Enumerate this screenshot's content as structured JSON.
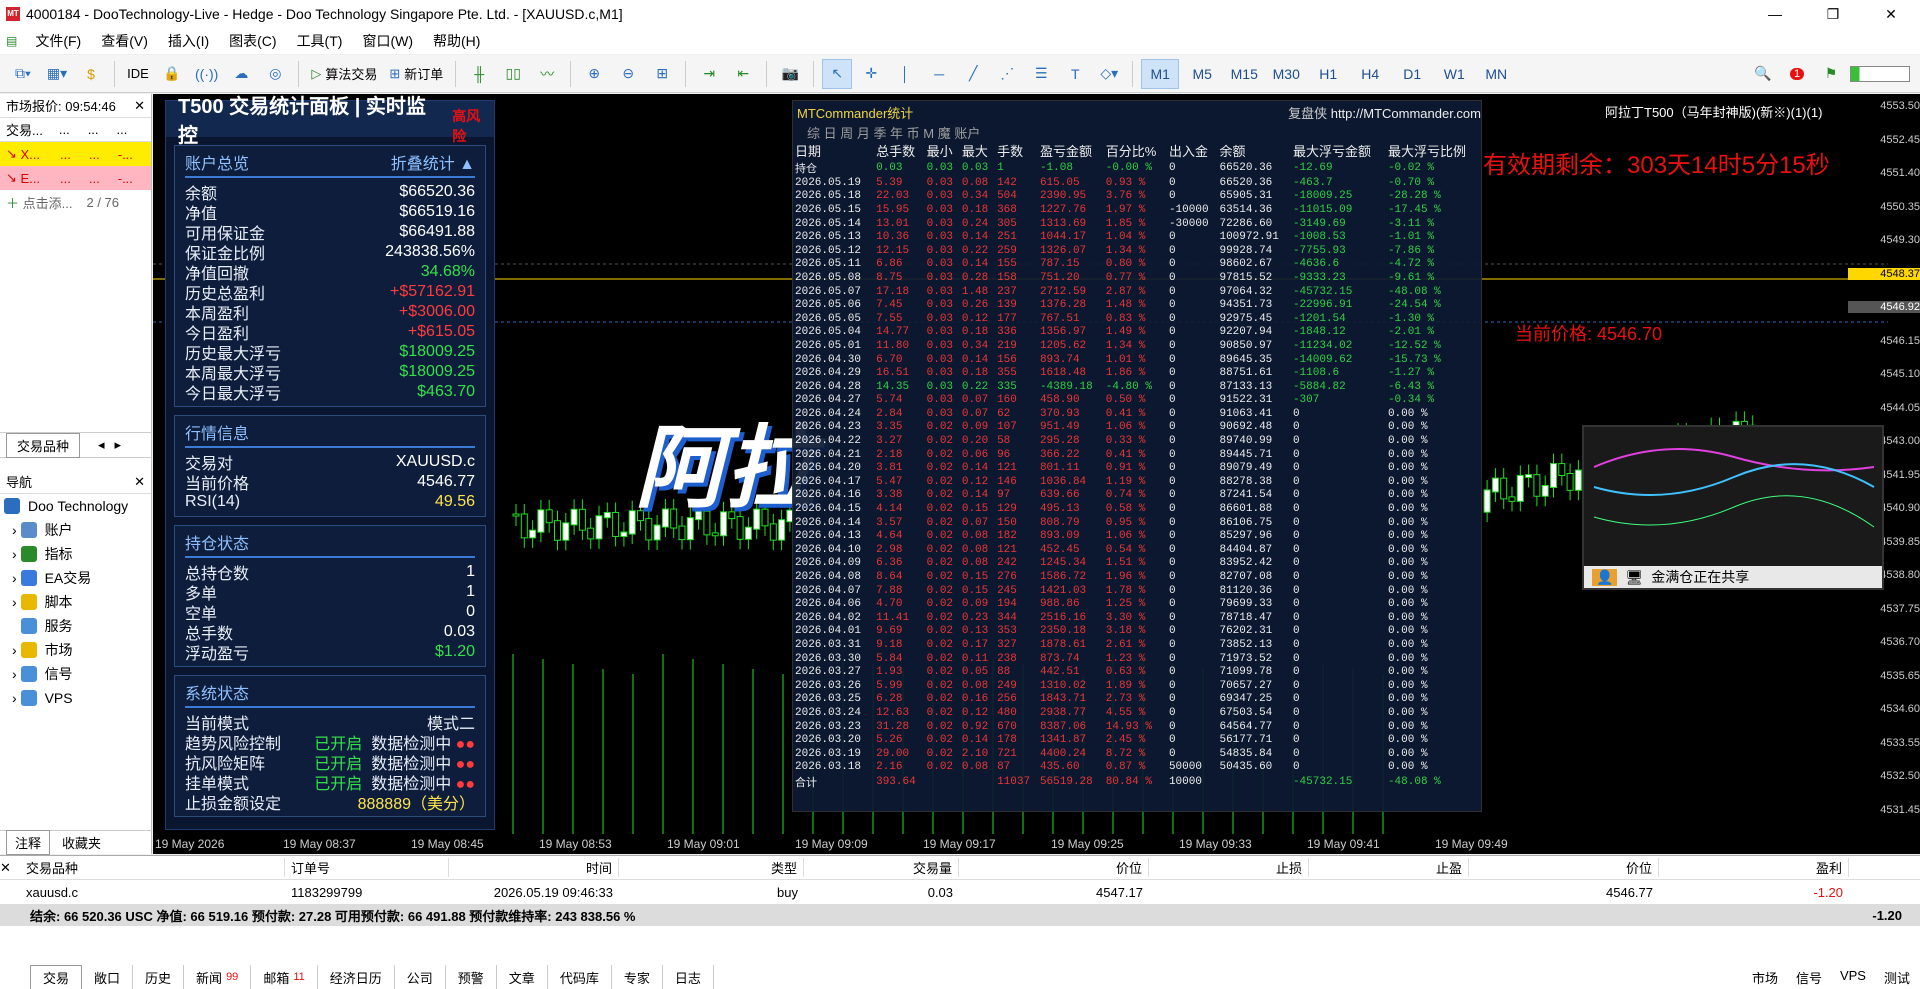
{
  "window": {
    "title": "4000184 - DooTechnology-Live - Hedge - Doo Technology Singapore Pte. Ltd. - [XAUUSD.c,M1]"
  },
  "menu": [
    "文件(F)",
    "查看(V)",
    "插入(I)",
    "图表(C)",
    "工具(T)",
    "窗口(W)",
    "帮助(H)"
  ],
  "toolbar": {
    "ide": "IDE",
    "algo_trading": "算法交易",
    "new_order": "新订单",
    "timeframes": [
      "M1",
      "M5",
      "M15",
      "M30",
      "H1",
      "H4",
      "D1",
      "W1",
      "MN"
    ],
    "active_timeframe": "M1",
    "notification_count": "1"
  },
  "market_watch": {
    "header": "市场报价: 09:54:46",
    "col": "交易...",
    "rows": [
      {
        "symbol": "X...",
        "bg": "#ffec00"
      },
      {
        "symbol": "E...",
        "bg": "#ffb6c1"
      }
    ],
    "add_label": "点击添...",
    "count": "2 / 76",
    "tab": "交易品种"
  },
  "navigator": {
    "header": "导航",
    "broker": "Doo Technology",
    "items": [
      "账户",
      "指标",
      "EA交易",
      "脚本",
      "服务",
      "市场",
      "信号",
      "VPS"
    ],
    "tabs": [
      "注释",
      "收藏夹"
    ]
  },
  "stats_panel": {
    "title": "T500 交易统计面板 | 实时监控",
    "risk": "高风险",
    "account": {
      "title": "账户总览",
      "collapse": "折叠统计 ▲",
      "rows": [
        {
          "k": "余额",
          "v": "$66520.36",
          "c": ""
        },
        {
          "k": "净值",
          "v": "$66519.16",
          "c": ""
        },
        {
          "k": "可用保证金",
          "v": "$66491.88",
          "c": ""
        },
        {
          "k": "保证金比例",
          "v": "243838.56%",
          "c": ""
        },
        {
          "k": "净值回撤",
          "v": "34.68%",
          "c": "g"
        },
        {
          "k": "历史总盈利",
          "v": "+$57162.91",
          "c": "r"
        },
        {
          "k": "本周盈利",
          "v": "+$3006.00",
          "c": "r"
        },
        {
          "k": "今日盈利",
          "v": "+$615.05",
          "c": "r"
        },
        {
          "k": "历史最大浮亏",
          "v": "$18009.25",
          "c": "g"
        },
        {
          "k": "本周最大浮亏",
          "v": "$18009.25",
          "c": "g"
        },
        {
          "k": "今日最大浮亏",
          "v": "$463.70",
          "c": "g"
        }
      ]
    },
    "market": {
      "title": "行情信息",
      "rows": [
        {
          "k": "交易对",
          "v": "XAUUSD.c",
          "c": ""
        },
        {
          "k": "当前价格",
          "v": "4546.77",
          "c": ""
        },
        {
          "k": "RSI(14)",
          "v": "49.56",
          "c": "y"
        }
      ]
    },
    "position": {
      "title": "持仓状态",
      "rows": [
        {
          "k": "总持仓数",
          "v": "1",
          "c": ""
        },
        {
          "k": "多单",
          "v": "1",
          "c": ""
        },
        {
          "k": "空单",
          "v": "0",
          "c": ""
        },
        {
          "k": "总手数",
          "v": "0.03",
          "c": ""
        },
        {
          "k": "浮动盈亏",
          "v": "$1.20",
          "c": "g"
        }
      ]
    },
    "system": {
      "title": "系统状态",
      "mode_label": "当前模式",
      "mode_value": "模式二",
      "rows": [
        {
          "k": "趋势风险控制",
          "s": "已开启",
          "d": "数据检测中"
        },
        {
          "k": "抗风险矩阵",
          "s": "已开启",
          "d": "数据检测中"
        },
        {
          "k": "挂单模式",
          "s": "已开启",
          "d": "数据检测中"
        }
      ],
      "stop_label": "止损金额设定",
      "stop_value": "888889（美分）"
    }
  },
  "mtc": {
    "title": "MTCommander统计",
    "review": "复盘侠",
    "url": "http://MTCommander.com",
    "tabs": "综 日 周 月 季 年 币 M 魔 账户",
    "headers": [
      "日期",
      "总手数",
      "最小",
      "最大",
      "手数",
      "盈亏金额",
      "百分比%",
      "出入金",
      "余额",
      "最大浮亏金额",
      "最大浮亏比例"
    ],
    "rows": [
      [
        "持仓",
        "0.03",
        "0.03",
        "0.03",
        "1",
        "-1.08",
        "-0.00 %",
        "0",
        "66520.36",
        "-12.69",
        "-0.02 %"
      ],
      [
        "2026.05.19",
        "5.39",
        "0.03",
        "0.08",
        "142",
        "615.05",
        "0.93 %",
        "0",
        "66520.36",
        "-463.7",
        "-0.70 %"
      ],
      [
        "2026.05.18",
        "22.03",
        "0.03",
        "0.34",
        "504",
        "2390.95",
        "3.76 %",
        "0",
        "65905.31",
        "-18009.25",
        "-28.28 %"
      ],
      [
        "2026.05.15",
        "15.95",
        "0.03",
        "0.18",
        "368",
        "1227.76",
        "1.97 %",
        "-10000",
        "63514.36",
        "-11015.09",
        "-17.45 %"
      ],
      [
        "2026.05.14",
        "13.01",
        "0.03",
        "0.24",
        "305",
        "1313.69",
        "1.85 %",
        "-30000",
        "72286.60",
        "-3149.69",
        "-3.11 %"
      ],
      [
        "2026.05.13",
        "10.36",
        "0.03",
        "0.14",
        "251",
        "1044.17",
        "1.04 %",
        "0",
        "100972.91",
        "-1008.53",
        "-1.01 %"
      ],
      [
        "2026.05.12",
        "12.15",
        "0.03",
        "0.22",
        "259",
        "1326.07",
        "1.34 %",
        "0",
        "99928.74",
        "-7755.93",
        "-7.86 %"
      ],
      [
        "2026.05.11",
        "6.86",
        "0.03",
        "0.14",
        "155",
        "787.15",
        "0.80 %",
        "0",
        "98602.67",
        "-4636.6",
        "-4.72 %"
      ],
      [
        "2026.05.08",
        "8.75",
        "0.03",
        "0.28",
        "158",
        "751.20",
        "0.77 %",
        "0",
        "97815.52",
        "-9333.23",
        "-9.61 %"
      ],
      [
        "2026.05.07",
        "17.18",
        "0.03",
        "1.48",
        "237",
        "2712.59",
        "2.87 %",
        "0",
        "97064.32",
        "-45732.15",
        "-48.08 %"
      ],
      [
        "2026.05.06",
        "7.45",
        "0.03",
        "0.26",
        "139",
        "1376.28",
        "1.48 %",
        "0",
        "94351.73",
        "-22996.91",
        "-24.54 %"
      ],
      [
        "2026.05.05",
        "7.55",
        "0.03",
        "0.12",
        "177",
        "767.51",
        "0.83 %",
        "0",
        "92975.45",
        "-1201.54",
        "-1.30 %"
      ],
      [
        "2026.05.04",
        "14.77",
        "0.03",
        "0.18",
        "336",
        "1356.97",
        "1.49 %",
        "0",
        "92207.94",
        "-1848.12",
        "-2.01 %"
      ],
      [
        "2026.05.01",
        "11.80",
        "0.03",
        "0.34",
        "219",
        "1205.62",
        "1.34 %",
        "0",
        "90850.97",
        "-11234.02",
        "-12.52 %"
      ],
      [
        "2026.04.30",
        "6.70",
        "0.03",
        "0.14",
        "156",
        "893.74",
        "1.01 %",
        "0",
        "89645.35",
        "-14009.62",
        "-15.73 %"
      ],
      [
        "2026.04.29",
        "16.51",
        "0.03",
        "0.18",
        "355",
        "1618.48",
        "1.86 %",
        "0",
        "88751.61",
        "-1108.6",
        "-1.27 %"
      ],
      [
        "2026.04.28",
        "14.35",
        "0.03",
        "0.22",
        "335",
        "-4389.18",
        "-4.80 %",
        "0",
        "87133.13",
        "-5884.82",
        "-6.43 %"
      ],
      [
        "2026.04.27",
        "5.74",
        "0.03",
        "0.07",
        "160",
        "458.90",
        "0.50 %",
        "0",
        "91522.31",
        "-307",
        "-0.34 %"
      ],
      [
        "2026.04.24",
        "2.84",
        "0.03",
        "0.07",
        "62",
        "370.93",
        "0.41 %",
        "0",
        "91063.41",
        "0",
        "0.00 %"
      ],
      [
        "2026.04.23",
        "3.35",
        "0.02",
        "0.09",
        "107",
        "951.49",
        "1.06 %",
        "0",
        "90692.48",
        "0",
        "0.00 %"
      ],
      [
        "2026.04.22",
        "3.27",
        "0.02",
        "0.20",
        "58",
        "295.28",
        "0.33 %",
        "0",
        "89740.99",
        "0",
        "0.00 %"
      ],
      [
        "2026.04.21",
        "2.18",
        "0.02",
        "0.06",
        "96",
        "366.22",
        "0.41 %",
        "0",
        "89445.71",
        "0",
        "0.00 %"
      ],
      [
        "2026.04.20",
        "3.81",
        "0.02",
        "0.14",
        "121",
        "801.11",
        "0.91 %",
        "0",
        "89079.49",
        "0",
        "0.00 %"
      ],
      [
        "2026.04.17",
        "5.47",
        "0.02",
        "0.12",
        "146",
        "1036.84",
        "1.19 %",
        "0",
        "88278.38",
        "0",
        "0.00 %"
      ],
      [
        "2026.04.16",
        "3.38",
        "0.02",
        "0.14",
        "97",
        "639.66",
        "0.74 %",
        "0",
        "87241.54",
        "0",
        "0.00 %"
      ],
      [
        "2026.04.15",
        "4.14",
        "0.02",
        "0.15",
        "129",
        "495.13",
        "0.58 %",
        "0",
        "86601.88",
        "0",
        "0.00 %"
      ],
      [
        "2026.04.14",
        "3.57",
        "0.02",
        "0.07",
        "150",
        "808.79",
        "0.95 %",
        "0",
        "86106.75",
        "0",
        "0.00 %"
      ],
      [
        "2026.04.13",
        "4.64",
        "0.02",
        "0.08",
        "182",
        "893.09",
        "1.06 %",
        "0",
        "85297.96",
        "0",
        "0.00 %"
      ],
      [
        "2026.04.10",
        "2.98",
        "0.02",
        "0.08",
        "121",
        "452.45",
        "0.54 %",
        "0",
        "84404.87",
        "0",
        "0.00 %"
      ],
      [
        "2026.04.09",
        "6.36",
        "0.02",
        "0.08",
        "242",
        "1245.34",
        "1.51 %",
        "0",
        "83952.42",
        "0",
        "0.00 %"
      ],
      [
        "2026.04.08",
        "8.64",
        "0.02",
        "0.15",
        "276",
        "1586.72",
        "1.96 %",
        "0",
        "82707.08",
        "0",
        "0.00 %"
      ],
      [
        "2026.04.07",
        "7.88",
        "0.02",
        "0.15",
        "245",
        "1421.03",
        "1.78 %",
        "0",
        "81120.36",
        "0",
        "0.00 %"
      ],
      [
        "2026.04.06",
        "4.70",
        "0.02",
        "0.09",
        "194",
        "988.86",
        "1.25 %",
        "0",
        "79699.33",
        "0",
        "0.00 %"
      ],
      [
        "2026.04.02",
        "11.41",
        "0.02",
        "0.23",
        "344",
        "2516.16",
        "3.30 %",
        "0",
        "78718.47",
        "0",
        "0.00 %"
      ],
      [
        "2026.04.01",
        "9.69",
        "0.02",
        "0.13",
        "353",
        "2350.18",
        "3.18 %",
        "0",
        "76202.31",
        "0",
        "0.00 %"
      ],
      [
        "2026.03.31",
        "9.18",
        "0.02",
        "0.17",
        "327",
        "1878.61",
        "2.61 %",
        "0",
        "73852.13",
        "0",
        "0.00 %"
      ],
      [
        "2026.03.30",
        "5.84",
        "0.02",
        "0.11",
        "238",
        "873.74",
        "1.23 %",
        "0",
        "71973.52",
        "0",
        "0.00 %"
      ],
      [
        "2026.03.27",
        "1.93",
        "0.02",
        "0.05",
        "88",
        "442.51",
        "0.63 %",
        "0",
        "71099.78",
        "0",
        "0.00 %"
      ],
      [
        "2026.03.26",
        "5.99",
        "0.02",
        "0.08",
        "249",
        "1310.02",
        "1.89 %",
        "0",
        "70657.27",
        "0",
        "0.00 %"
      ],
      [
        "2026.03.25",
        "6.28",
        "0.02",
        "0.16",
        "256",
        "1843.71",
        "2.73 %",
        "0",
        "69347.25",
        "0",
        "0.00 %"
      ],
      [
        "2026.03.24",
        "12.63",
        "0.02",
        "0.12",
        "480",
        "2938.77",
        "4.55 %",
        "0",
        "67503.54",
        "0",
        "0.00 %"
      ],
      [
        "2026.03.23",
        "31.28",
        "0.02",
        "0.92",
        "670",
        "8387.06",
        "14.93 %",
        "0",
        "64564.77",
        "0",
        "0.00 %"
      ],
      [
        "2026.03.20",
        "5.26",
        "0.02",
        "0.14",
        "178",
        "1341.87",
        "2.45 %",
        "0",
        "56177.71",
        "0",
        "0.00 %"
      ],
      [
        "2026.03.19",
        "29.00",
        "0.02",
        "2.10",
        "721",
        "4400.24",
        "8.72 %",
        "0",
        "54835.84",
        "0",
        "0.00 %"
      ],
      [
        "2026.03.18",
        "2.16",
        "0.02",
        "0.08",
        "87",
        "435.60",
        "0.87 %",
        "50000",
        "50435.60",
        "0",
        "0.00 %"
      ],
      [
        "合计",
        "393.64",
        "",
        "",
        "11037",
        "56519.28",
        "80.84 %",
        "10000",
        "",
        "-45732.15",
        "-48.08 %"
      ]
    ]
  },
  "chart": {
    "symbol_label": "阿拉丁T500（马年封神版)(新※)(1)(1)",
    "banner": "有效期剩余：303天14时5分15秒",
    "current_price": "当前价格: 4546.70",
    "big_text": "阿拉",
    "yticks": [
      "4553.50",
      "4552.45",
      "4551.40",
      "4550.35",
      "4549.30",
      "4548.37",
      "4546.92",
      "4546.15",
      "4545.10",
      "4544.05",
      "4543.00",
      "4541.95",
      "4540.90",
      "4539.85",
      "4538.80",
      "4537.75",
      "4536.70",
      "4535.65",
      "4534.60",
      "4533.55",
      "4532.50",
      "4531.45"
    ],
    "times": [
      "19 May 2026",
      "19 May 08:37",
      "19 May 08:45",
      "19 May 08:53",
      "19 May 09:01",
      "19 May 09:09",
      "19 May 09:17",
      "19 May 09:25",
      "19 May 09:33",
      "19 May 09:41",
      "19 May 09:49"
    ]
  },
  "pip": {
    "label": "金满仓正在共享"
  },
  "bottom": {
    "headers": [
      "交易品种",
      "订单号",
      "时间",
      "类型",
      "交易量",
      "价位",
      "止损",
      "止盈",
      "价位",
      "盈利"
    ],
    "row": [
      "xauusd.c",
      "1183299799",
      "2026.05.19 09:46:33",
      "buy",
      "0.03",
      "4547.17",
      "",
      "",
      "4546.77",
      "-1.20"
    ],
    "summary": "结余: 66 520.36 USC  净值: 66 519.16  预付款: 27.28  可用预付款: 66 491.88  预付款维持率: 243 838.56 %",
    "summary_profit": "-1.20",
    "tabs": [
      "交易",
      "敞口",
      "历史",
      "新闻",
      "邮箱",
      "经济日历",
      "公司",
      "预警",
      "文章",
      "代码库",
      "专家",
      "日志"
    ],
    "news_badge": "99",
    "mail_badge": "11",
    "status": [
      "市场",
      "信号",
      "VPS",
      "测试"
    ]
  }
}
